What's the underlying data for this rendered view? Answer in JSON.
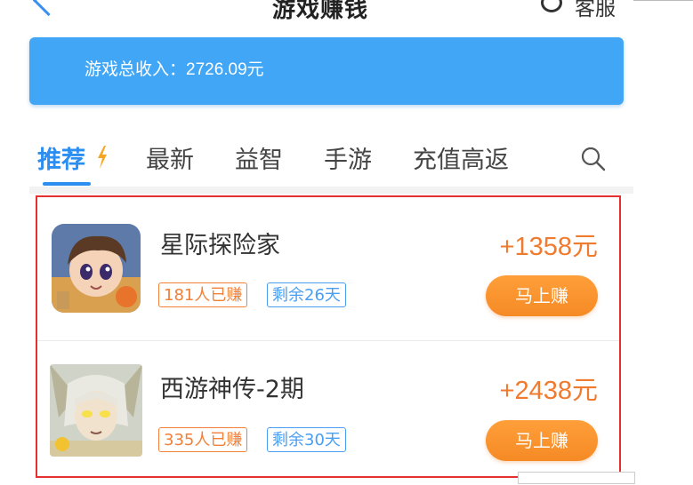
{
  "header": {
    "title": "游戏赚钱",
    "service_label": "客服"
  },
  "banner": {
    "income_text": "游戏总收入：2726.09元"
  },
  "tabs": [
    {
      "label": "推荐",
      "active": true
    },
    {
      "label": "最新",
      "active": false
    },
    {
      "label": "益智",
      "active": false
    },
    {
      "label": "手游",
      "active": false
    },
    {
      "label": "充值高返",
      "active": false
    }
  ],
  "games": [
    {
      "name": "星际探险家",
      "earned_tag": "181人已赚",
      "days_tag": "剩余26天",
      "reward": "+1358元",
      "button": "马上赚"
    },
    {
      "name": "西游神传-2期",
      "earned_tag": "335人已赚",
      "days_tag": "剩余30天",
      "reward": "+2438元",
      "button": "马上赚"
    }
  ],
  "colors": {
    "accent_blue": "#2c8ef0",
    "banner_blue": "#40a6f5",
    "reward_orange": "#f07a2e",
    "highlight_red": "#e43030"
  },
  "icons": [
    "back-arrow-icon",
    "customer-service-icon",
    "lightning-icon",
    "search-icon"
  ]
}
